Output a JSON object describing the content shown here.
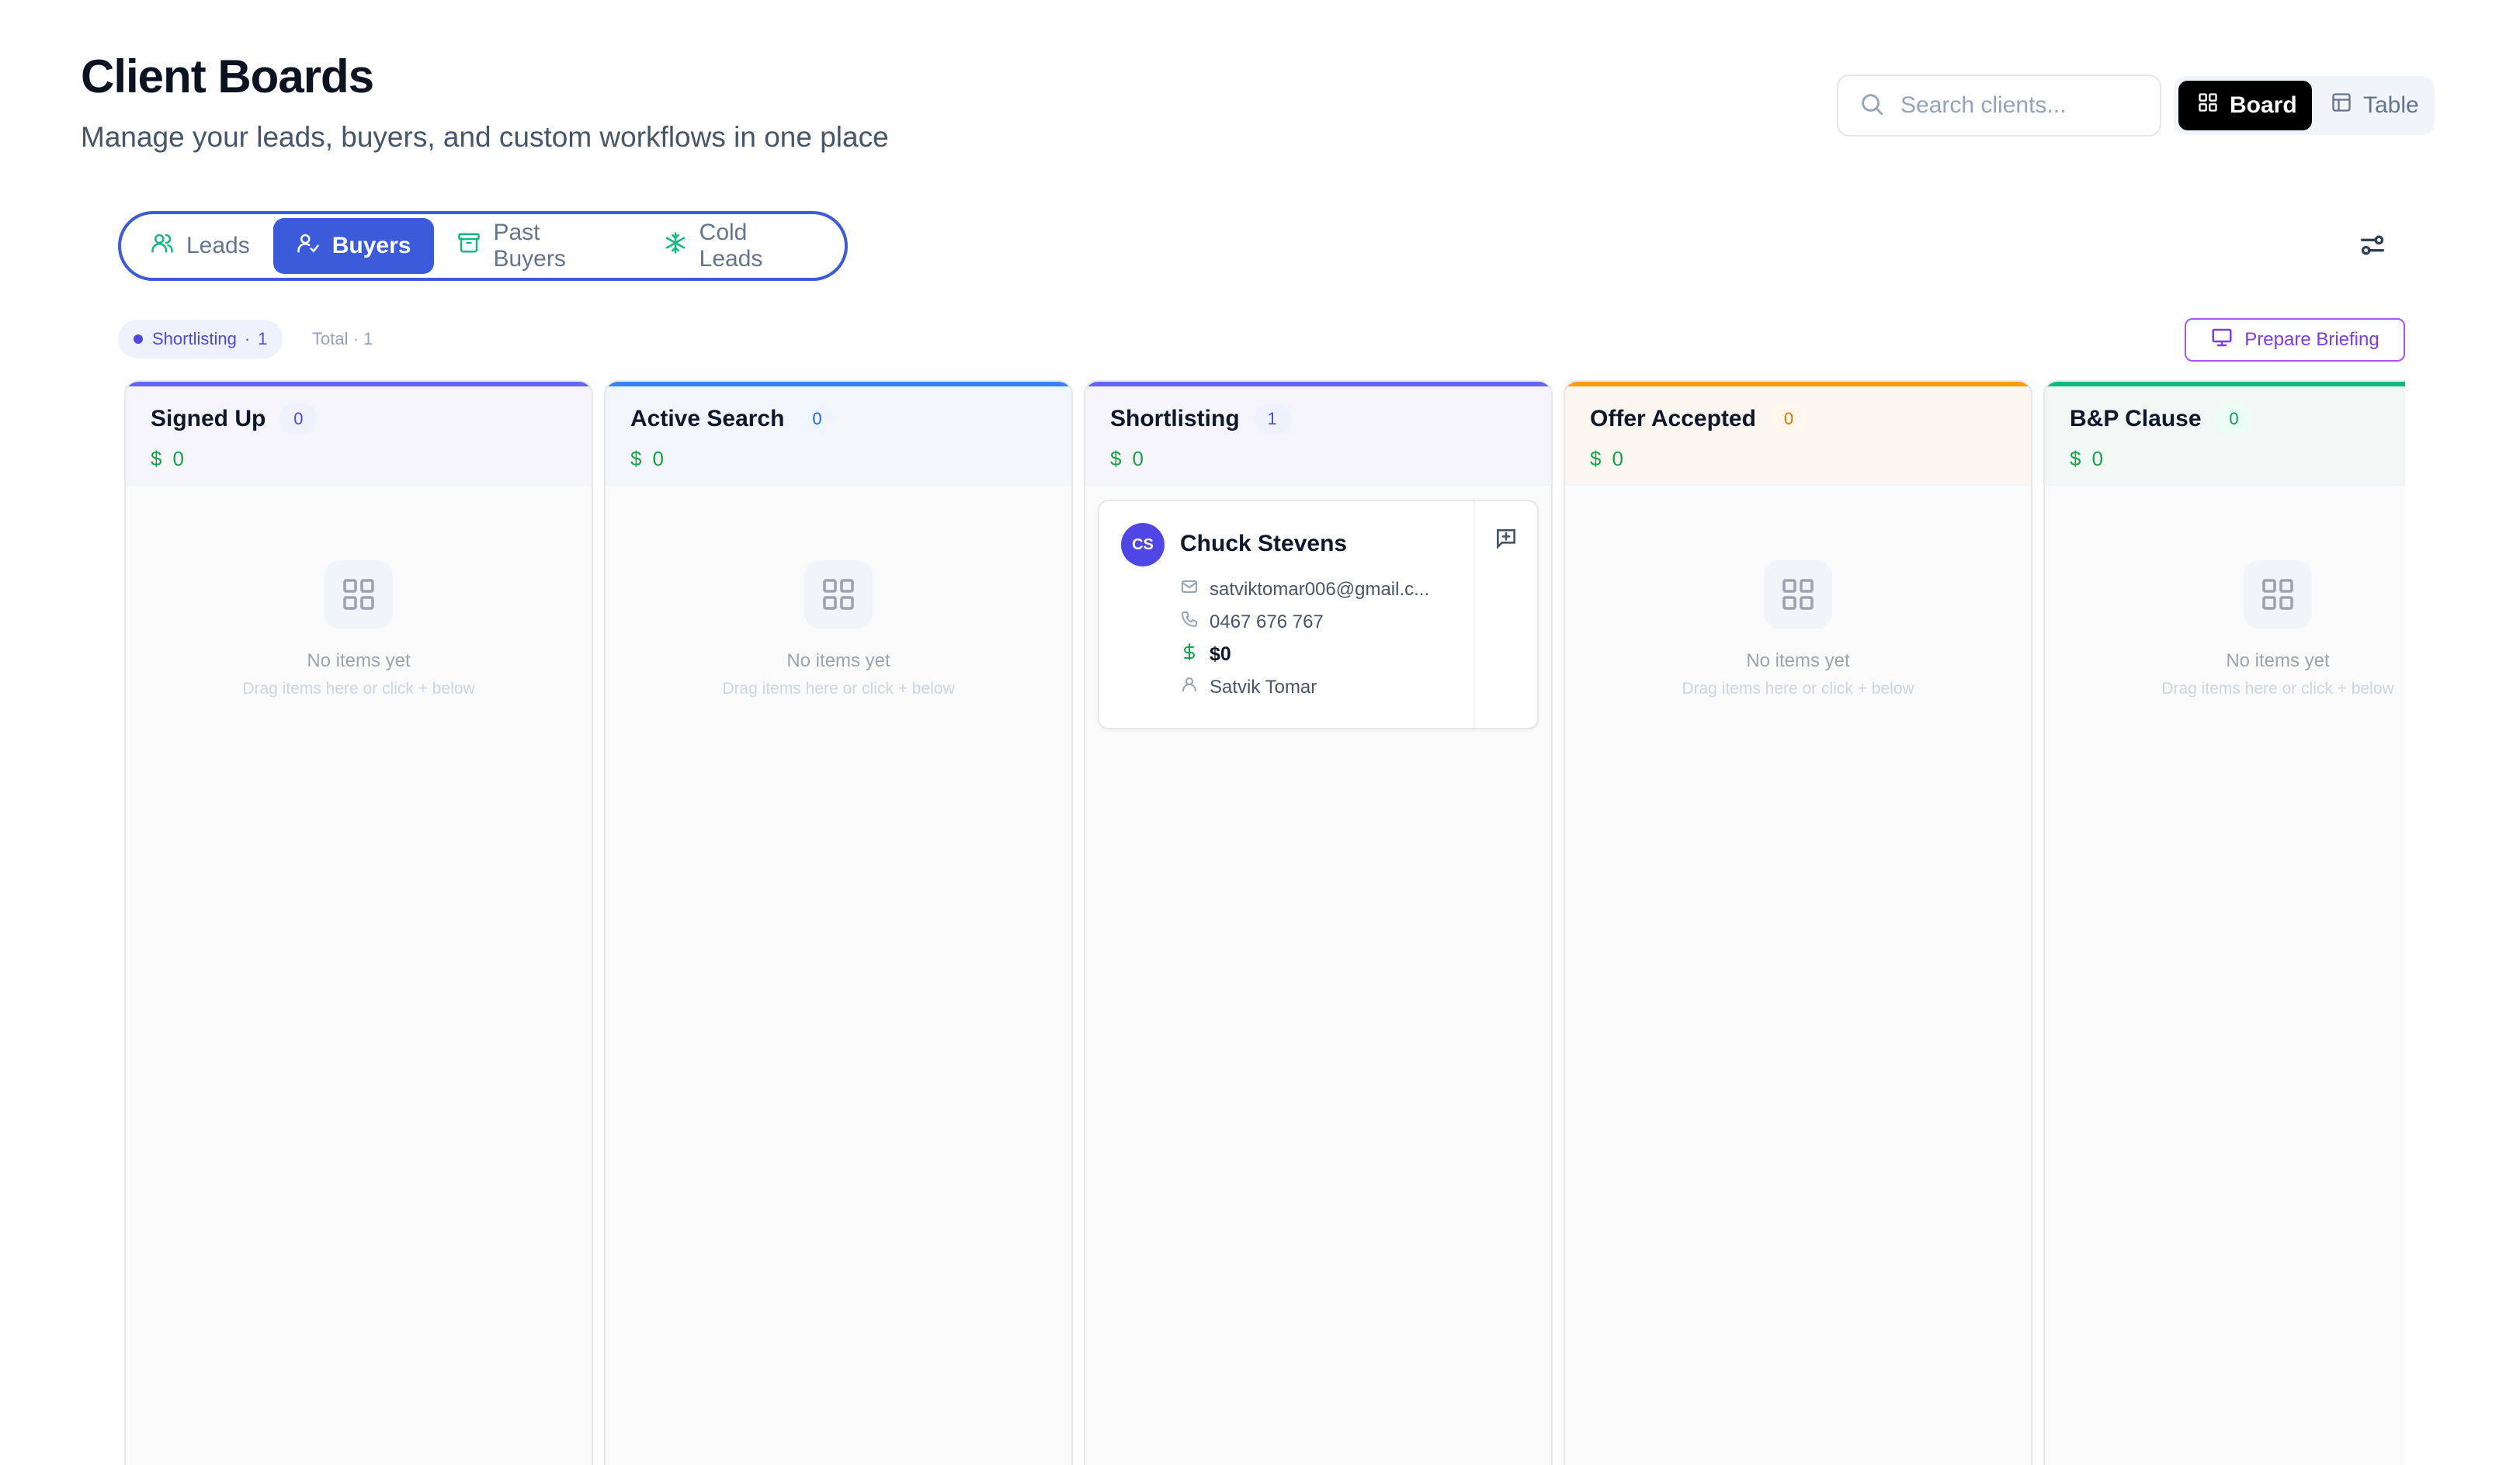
{
  "header": {
    "title": "Client Boards",
    "subtitle": "Manage your leads, buyers, and custom workflows in one place"
  },
  "search": {
    "placeholder": "Search clients..."
  },
  "view_toggle": {
    "board_label": "Board",
    "table_label": "Table",
    "active": "Board"
  },
  "type_tabs": [
    {
      "label": "Leads",
      "icon": "users-icon",
      "active": false
    },
    {
      "label": "Buyers",
      "icon": "user-check-icon",
      "active": true
    },
    {
      "label": "Past Buyers",
      "icon": "archive-icon",
      "active": false
    },
    {
      "label": "Cold Leads",
      "icon": "snowflake-icon",
      "active": false
    }
  ],
  "summary": {
    "stage_chip": {
      "label": "Shortlisting",
      "separator": "·",
      "count": "1"
    },
    "total": "Total · 1"
  },
  "prepare_briefing": {
    "label": "Prepare Briefing"
  },
  "empty_state": {
    "title": "No items yet",
    "subtitle": "Drag items here or click + below"
  },
  "colors": {
    "accent": "#3b5bdb",
    "money_green": "#16a34a",
    "briefing_purple": "#7c3aed"
  },
  "columns": [
    {
      "title": "Signed Up",
      "count": "0",
      "currency": "$",
      "amount": "0",
      "accent": "#6366f1",
      "count_bg": "#eef2ff",
      "count_fg": "#4f46e5"
    },
    {
      "title": "Active Search",
      "count": "0",
      "currency": "$",
      "amount": "0",
      "accent": "#3b82f6",
      "count_bg": "#eff6ff",
      "count_fg": "#2563eb"
    },
    {
      "title": "Shortlisting",
      "count": "1",
      "currency": "$",
      "amount": "0",
      "accent": "#6366f1",
      "count_bg": "#eef2ff",
      "count_fg": "#4f46e5",
      "cards": [
        {
          "initials": "CS",
          "name": "Chuck Stevens",
          "email": "satviktomar006@gmail.c...",
          "phone": "0467 676 767",
          "price": "$0",
          "agent": "Satvik Tomar"
        }
      ]
    },
    {
      "title": "Offer Accepted",
      "count": "0",
      "currency": "$",
      "amount": "0",
      "accent": "#f59e0b",
      "count_bg": "#fff7ed",
      "count_fg": "#d97706"
    },
    {
      "title": "B&P Clause",
      "count": "0",
      "currency": "$",
      "amount": "0",
      "accent": "#10b981",
      "count_bg": "#ecfdf5",
      "count_fg": "#059669"
    }
  ]
}
